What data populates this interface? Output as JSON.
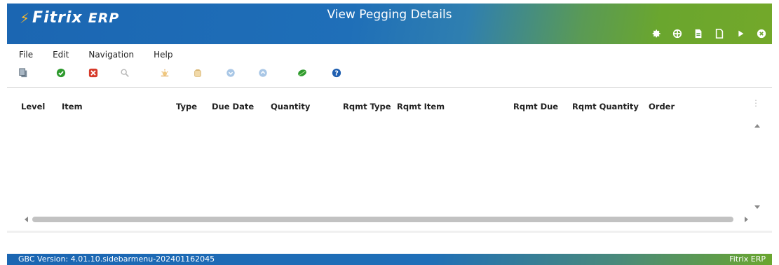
{
  "header": {
    "logo_text": "Fitrix",
    "logo_suffix": "ERP",
    "title": "View Pegging Details",
    "icons": [
      "gear-icon",
      "globe-icon",
      "document-icon",
      "blank-page-icon",
      "play-icon",
      "close-circle-icon"
    ]
  },
  "menu": {
    "items": [
      "File",
      "Edit",
      "Navigation",
      "Help"
    ]
  },
  "toolbar": {
    "icons": [
      "copy-icon",
      "accept-icon",
      "cancel-icon",
      "find-icon",
      "sun-icon",
      "reset-icon",
      "down-icon",
      "up-icon",
      "leaf-icon",
      "help-icon"
    ]
  },
  "table": {
    "columns": [
      "Level",
      "Item",
      "Type",
      "Due Date",
      "Quantity",
      "Rqmt Type",
      "Rqmt Item",
      "Rqmt Due",
      "Rqmt Quantity",
      "Order"
    ],
    "rows": []
  },
  "footer": {
    "version": "GBC Version: 4.01.10.sidebarmenu-202401162045",
    "brand": "Fitrix ERP"
  },
  "colors": {
    "header_blue": "#1b66b2",
    "header_green": "#73a82a",
    "accent_yellow": "#f5b731"
  }
}
